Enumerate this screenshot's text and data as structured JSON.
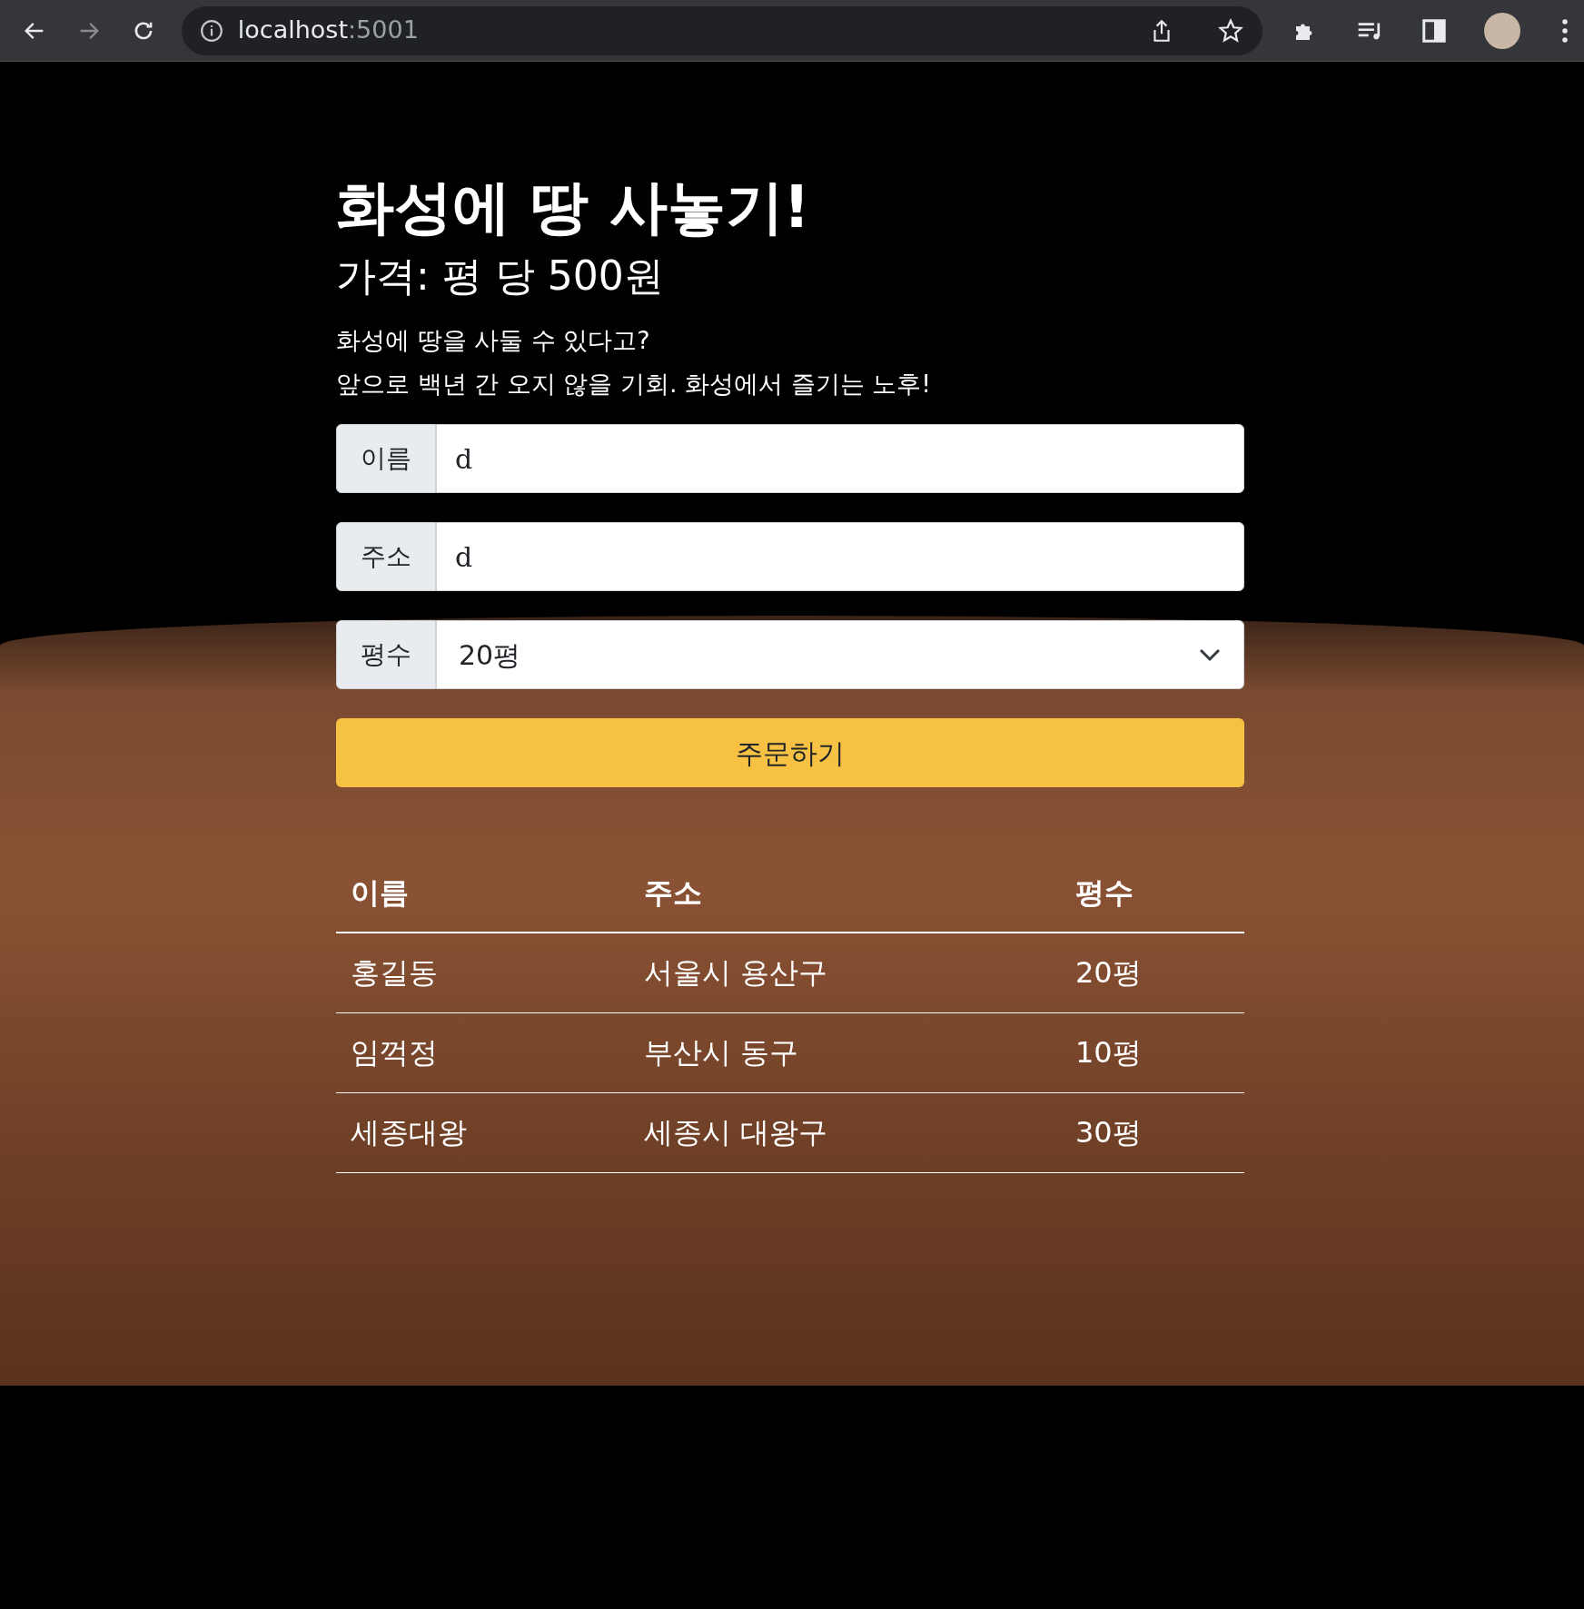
{
  "browser": {
    "url_host": "localhost",
    "url_port": ":5001",
    "forward_disabled": true
  },
  "heading": "화성에 땅 사놓기!",
  "subheading": "가격: 평 당 500원",
  "intro": [
    "화성에 땅을 사둘 수 있다고?",
    "앞으로 백년 간 오지 않을 기회. 화성에서 즐기는 노후!"
  ],
  "form": {
    "fields": [
      {
        "kind": "text",
        "label": "이름",
        "value": "d"
      },
      {
        "kind": "text",
        "label": "주소",
        "value": "d"
      },
      {
        "kind": "select",
        "label": "평수",
        "value": "20평"
      }
    ],
    "submit": "주문하기"
  },
  "table": {
    "columns": [
      "이름",
      "주소",
      "평수"
    ],
    "rows": [
      [
        "홍길동",
        "서울시 용산구",
        "20평"
      ],
      [
        "임꺽정",
        "부산시 동구",
        "10평"
      ],
      [
        "세종대왕",
        "세종시 대왕구",
        "30평"
      ]
    ]
  }
}
